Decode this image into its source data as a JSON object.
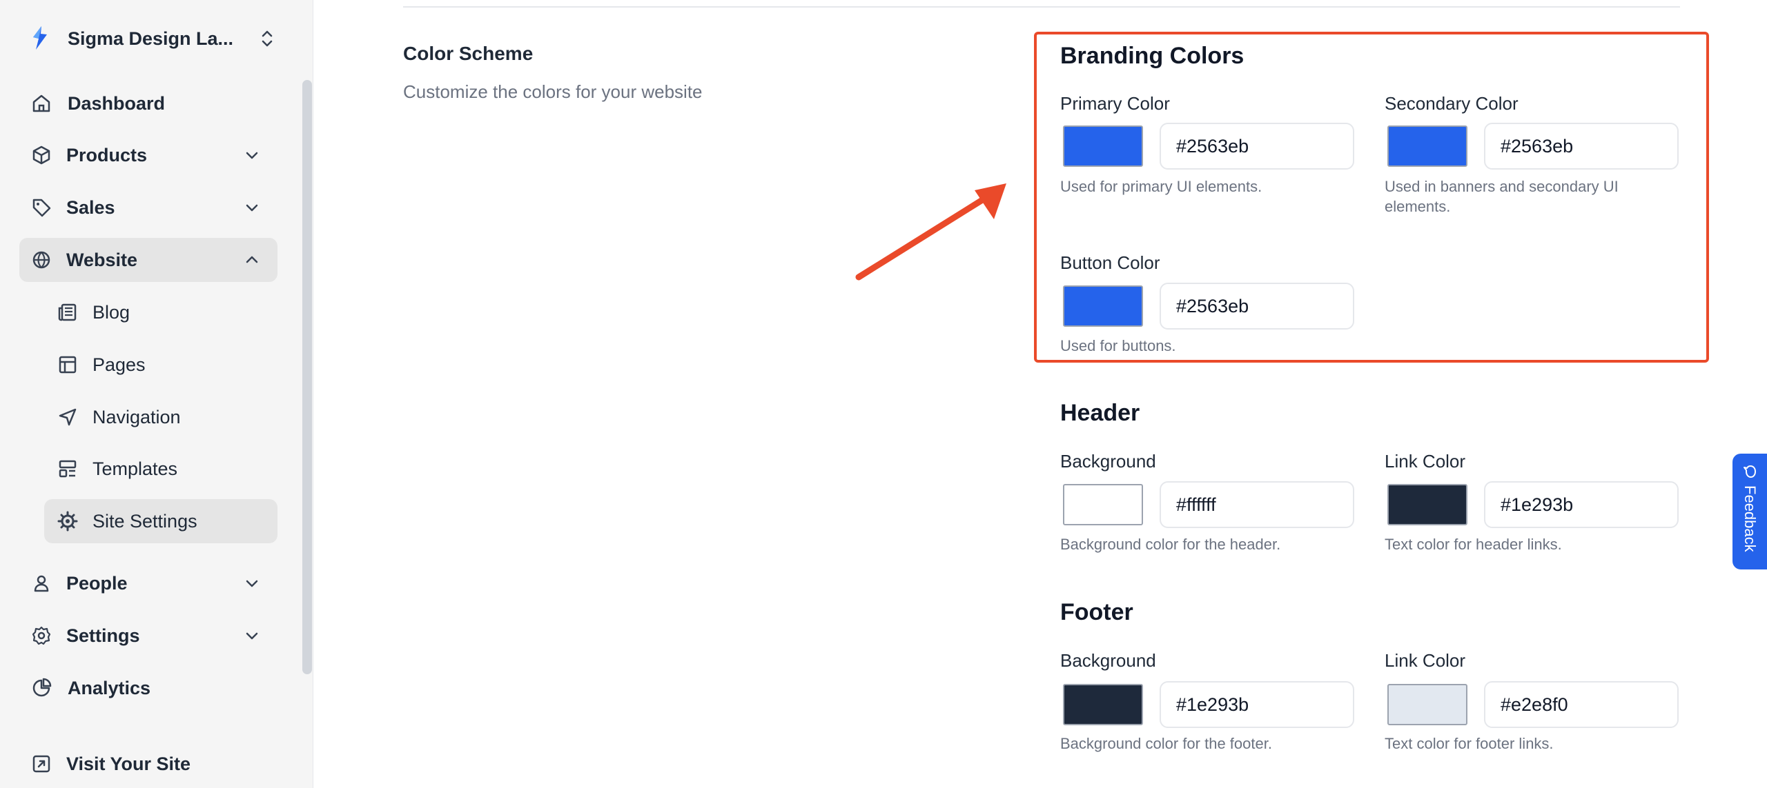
{
  "sidebar": {
    "brand_name": "Sigma Design La...",
    "items": [
      {
        "label": "Dashboard"
      },
      {
        "label": "Products"
      },
      {
        "label": "Sales"
      },
      {
        "label": "Website"
      },
      {
        "label": "Blog"
      },
      {
        "label": "Pages"
      },
      {
        "label": "Navigation"
      },
      {
        "label": "Templates"
      },
      {
        "label": "Site Settings"
      },
      {
        "label": "People"
      },
      {
        "label": "Settings"
      },
      {
        "label": "Analytics"
      },
      {
        "label": "Visit Your Site"
      }
    ]
  },
  "main": {
    "section_title": "Color Scheme",
    "section_desc": "Customize the colors for your website",
    "branding": {
      "title": "Branding Colors",
      "primary": {
        "label": "Primary Color",
        "value": "#2563eb",
        "help": "Used for primary UI elements."
      },
      "secondary": {
        "label": "Secondary Color",
        "value": "#2563eb",
        "help": "Used in banners and secondary UI elements."
      },
      "button": {
        "label": "Button Color",
        "value": "#2563eb",
        "help": "Used for buttons."
      }
    },
    "header": {
      "title": "Header",
      "background": {
        "label": "Background",
        "value": "#ffffff",
        "help": "Background color for the header."
      },
      "link": {
        "label": "Link Color",
        "value": "#1e293b",
        "help": "Text color for header links."
      }
    },
    "footer": {
      "title": "Footer",
      "background": {
        "label": "Background",
        "value": "#1e293b",
        "help": "Background color for the footer."
      },
      "link": {
        "label": "Link Color",
        "value": "#e2e8f0",
        "help": "Text color for footer links."
      }
    }
  },
  "feedback": {
    "label": "Feedback"
  },
  "colors": {
    "accent": "#2563eb",
    "highlight": "#ea4a2a"
  }
}
